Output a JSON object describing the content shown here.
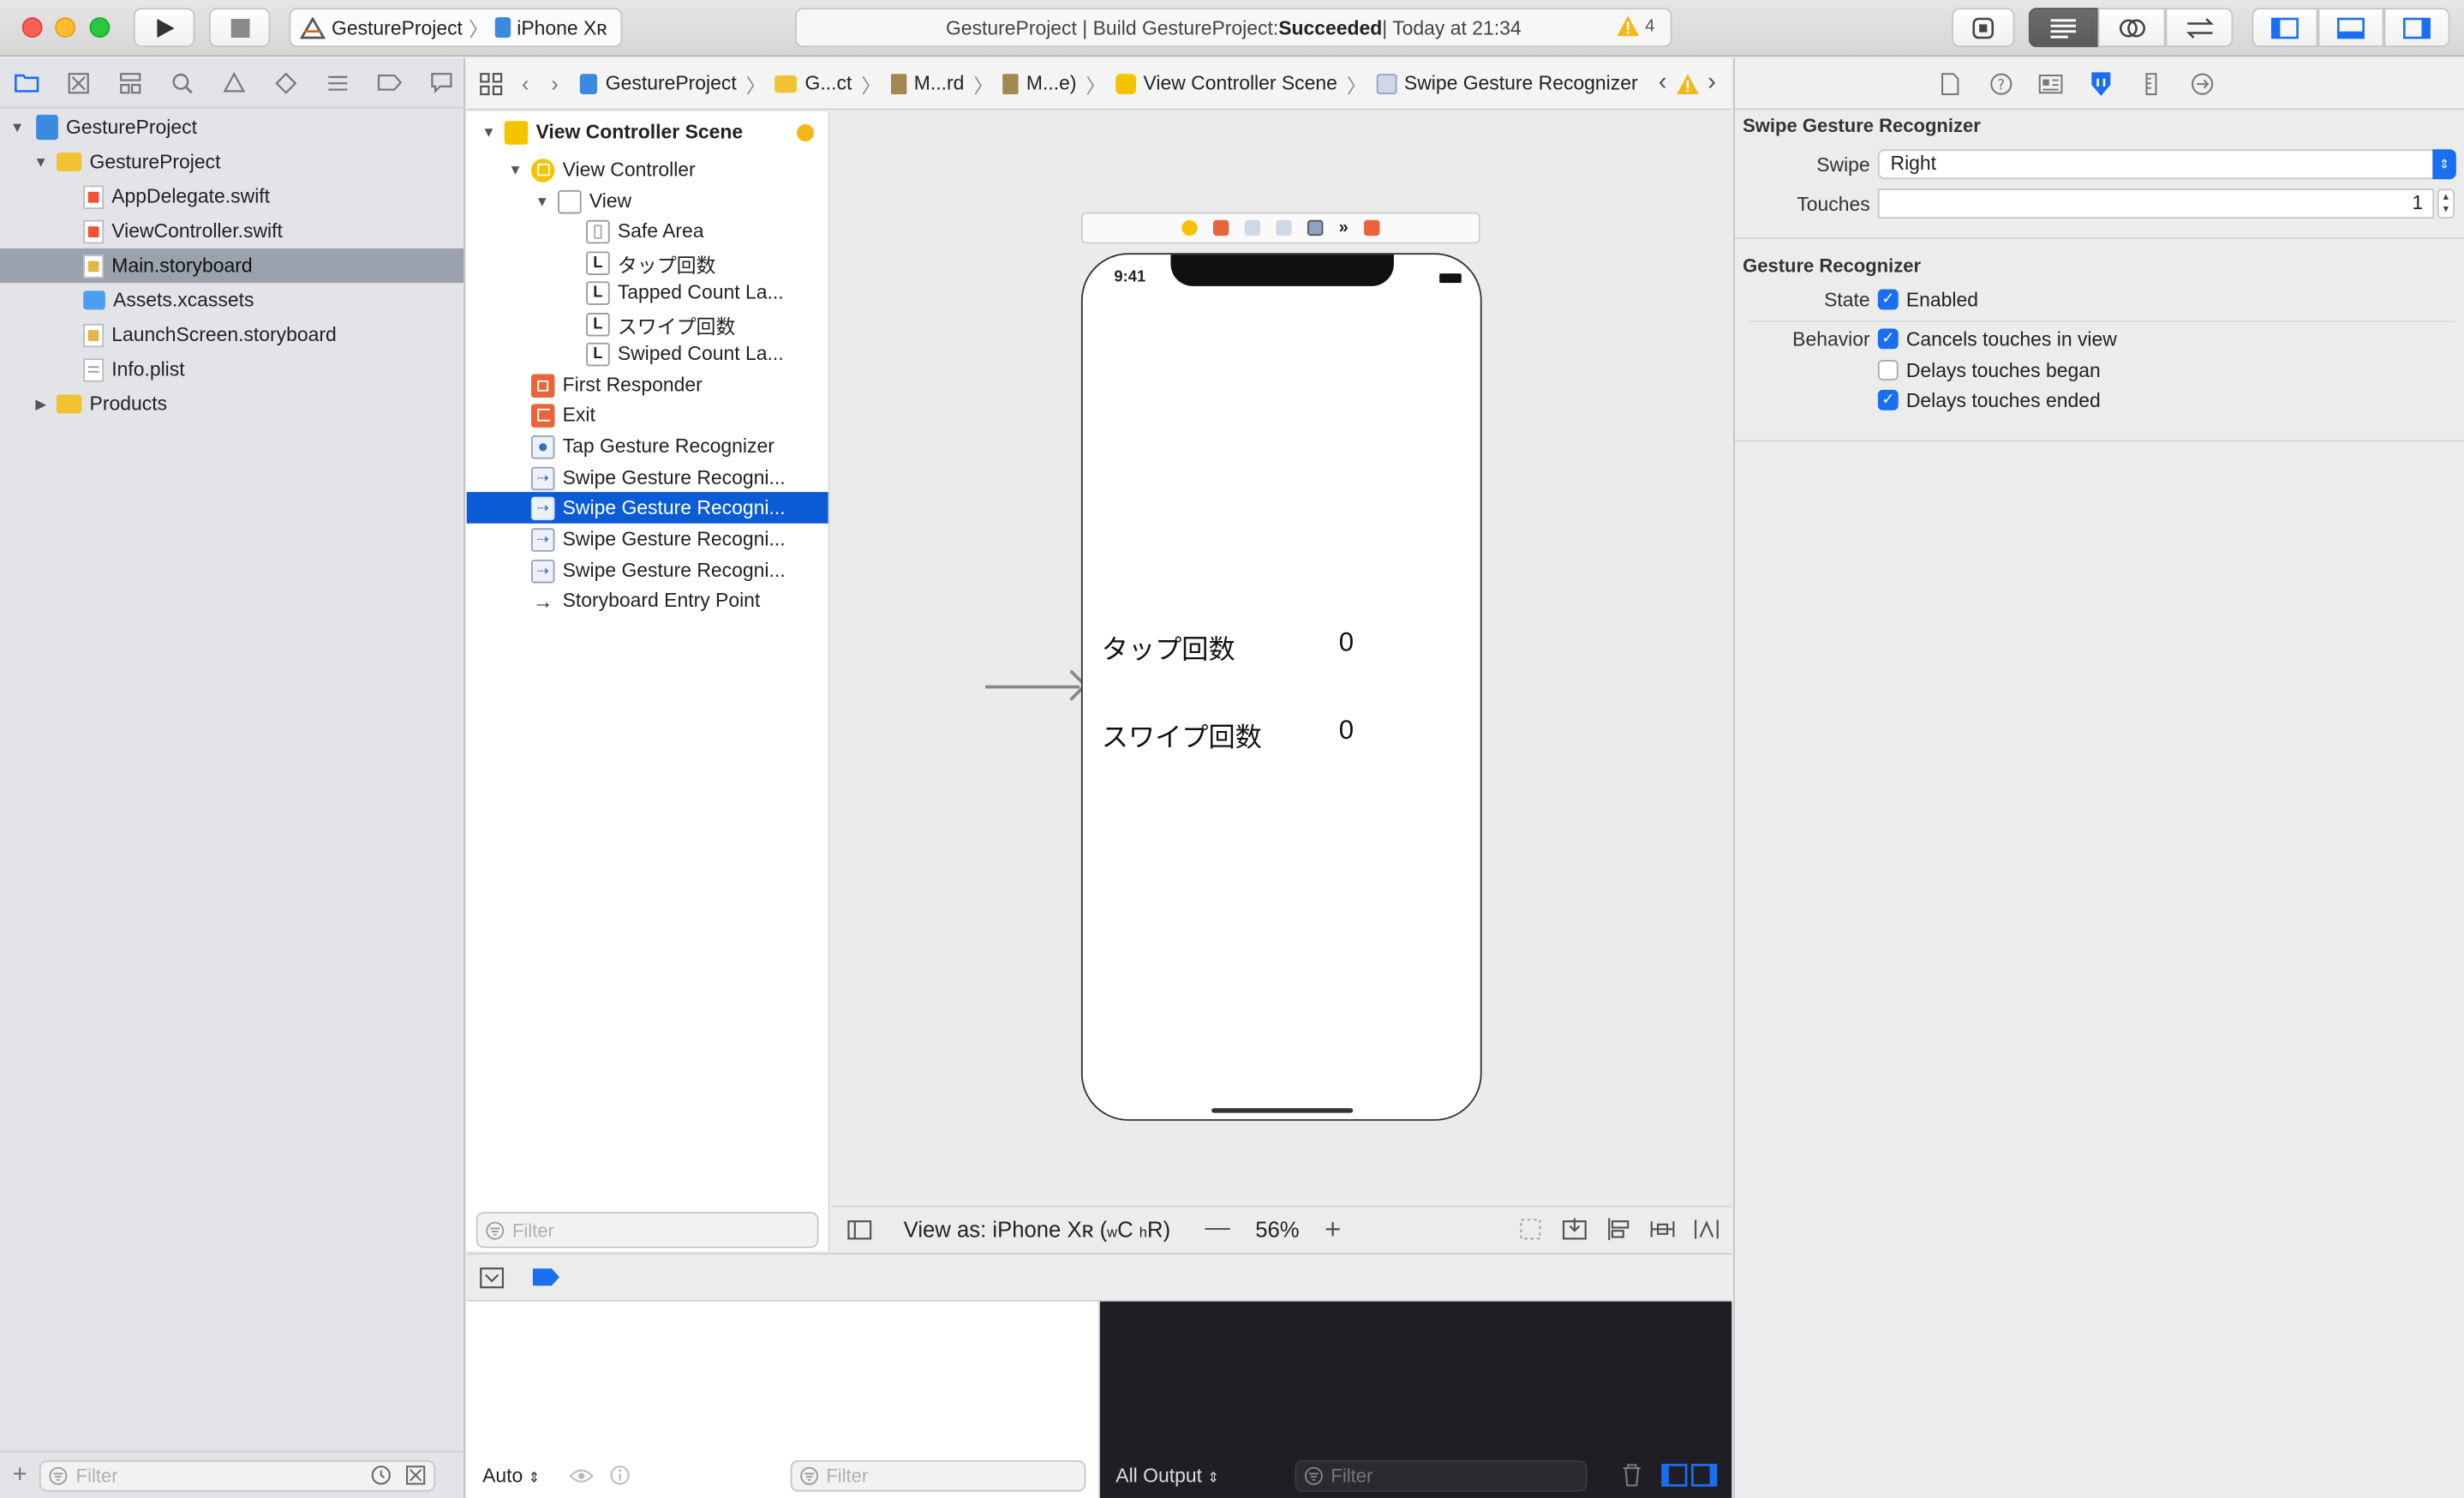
{
  "window": {
    "scheme_project": "GestureProject",
    "scheme_device": "iPhone Xʀ",
    "activity_prefix": "GestureProject | Build GestureProject: ",
    "activity_status": "Succeeded",
    "activity_suffix": " | Today at 21:34",
    "warning_count": "4"
  },
  "navigator": {
    "items": [
      {
        "label": "GestureProject",
        "kind": "project"
      },
      {
        "label": "GestureProject",
        "kind": "folder"
      },
      {
        "label": "AppDelegate.swift",
        "kind": "swift"
      },
      {
        "label": "ViewController.swift",
        "kind": "swift"
      },
      {
        "label": "Main.storyboard",
        "kind": "storyboard"
      },
      {
        "label": "Assets.xcassets",
        "kind": "assets"
      },
      {
        "label": "LaunchScreen.storyboard",
        "kind": "storyboard"
      },
      {
        "label": "Info.plist",
        "kind": "plist"
      },
      {
        "label": "Products",
        "kind": "folder"
      }
    ],
    "filter_placeholder": "Filter"
  },
  "jumpbar": {
    "crumbs": [
      "GestureProject",
      "G...ct",
      "M...rd",
      "M...e)",
      "View Controller Scene",
      "Swipe Gesture Recognizer"
    ]
  },
  "outline": {
    "items": [
      "View Controller Scene",
      "View Controller",
      "View",
      "Safe Area",
      "タップ回数",
      "Tapped Count La...",
      "スワイプ回数",
      "Swiped Count La...",
      "First Responder",
      "Exit",
      "Tap Gesture Recognizer",
      "Swipe Gesture Recogni...",
      "Swipe Gesture Recogni...",
      "Swipe Gesture Recogni...",
      "Swipe Gesture Recogni...",
      "Storyboard Entry Point"
    ],
    "filter_placeholder": "Filter"
  },
  "canvas": {
    "phone_time": "9:41",
    "tap_label": "タップ回数",
    "tap_count": "0",
    "swipe_label": "スワイプ回数",
    "swipe_count": "0",
    "view_as_prefix": "View as: iPhone Xʀ (",
    "view_as_w": "w",
    "view_as_c": "C",
    "view_as_h": "h",
    "view_as_r": "R",
    "view_as_suffix": ")",
    "zoom": "56%"
  },
  "debug": {
    "auto_label": "Auto",
    "var_filter_placeholder": "Filter",
    "output_label": "All Output",
    "console_filter_placeholder": "Filter"
  },
  "inspector": {
    "section1_title": "Swipe Gesture Recognizer",
    "swipe_label": "Swipe",
    "swipe_value": "Right",
    "touches_label": "Touches",
    "touches_value": "1",
    "section2_title": "Gesture Recognizer",
    "state_label": "State",
    "enabled_label": "Enabled",
    "behavior_label": "Behavior",
    "cancels_label": "Cancels touches in view",
    "delays_began_label": "Delays touches began",
    "delays_ended_label": "Delays touches ended",
    "enabled_checked": true,
    "cancels_checked": true,
    "delays_began_checked": false,
    "delays_ended_checked": true
  },
  "colors": {
    "selection_blue": "#0b5bd7",
    "nav_selection": "#9aa2ad",
    "check_blue": "#1a6ef0",
    "close": "#fe5f57",
    "minimize": "#febc2e",
    "zoom": "#28c840"
  }
}
